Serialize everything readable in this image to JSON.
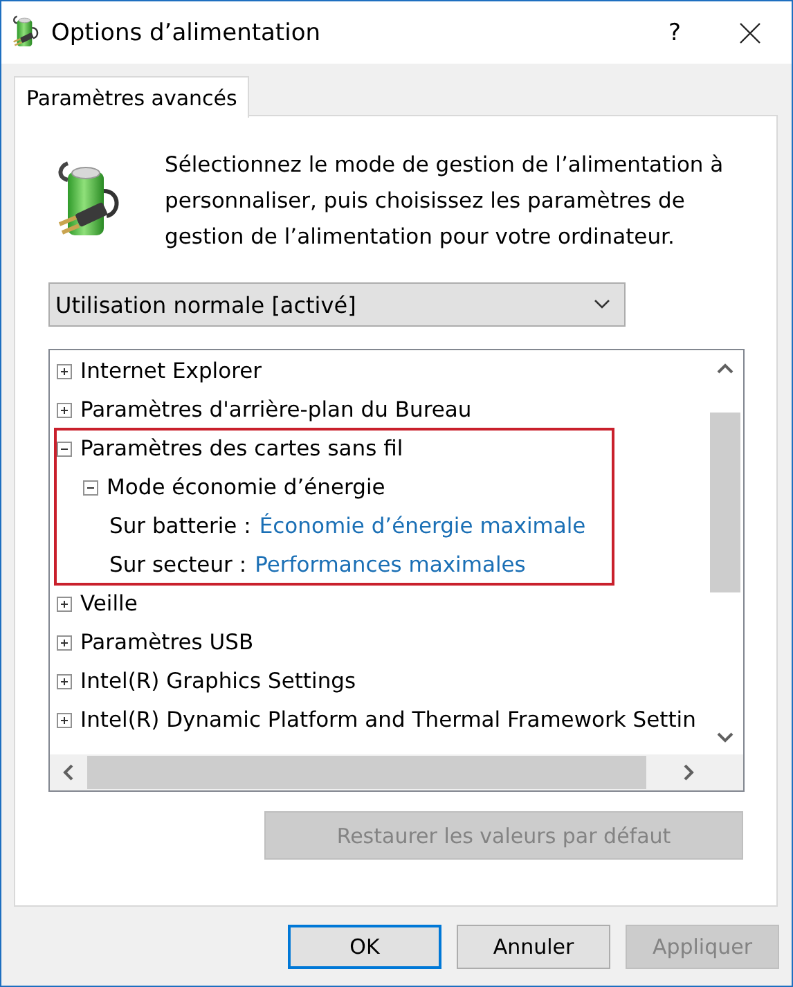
{
  "window": {
    "title": "Options d’alimentation",
    "help_button": "?"
  },
  "tabs": [
    {
      "label": "Paramètres avancés",
      "selected": true
    }
  ],
  "description": "Sélectionnez le mode de gestion de l’alimentation à personnaliser, puis choisissez les paramètres de gestion de l’alimentation pour votre ordinateur.",
  "plan_dropdown": {
    "value": "Utilisation normale [activé]"
  },
  "settings_tree": [
    {
      "kind": "group",
      "label": "Internet Explorer",
      "expanded": false,
      "highlighted": false
    },
    {
      "kind": "group",
      "label": "Paramètres d'arrière-plan du Bureau",
      "expanded": false,
      "highlighted": false
    },
    {
      "kind": "group",
      "label": "Paramètres des cartes sans fil",
      "expanded": true,
      "highlighted": true,
      "children": [
        {
          "kind": "group",
          "label": "Mode économie d’énergie",
          "expanded": true,
          "children": [
            {
              "kind": "value",
              "label": "Sur batterie :",
              "value": "Économie d’énergie maximale"
            },
            {
              "kind": "value",
              "label": "Sur secteur :",
              "value": "Performances maximales"
            }
          ]
        }
      ]
    },
    {
      "kind": "group",
      "label": "Veille",
      "expanded": false,
      "highlighted": false
    },
    {
      "kind": "group",
      "label": "Paramètres USB",
      "expanded": false,
      "highlighted": false
    },
    {
      "kind": "group",
      "label": "Intel(R) Graphics Settings",
      "expanded": false,
      "highlighted": false
    },
    {
      "kind": "group",
      "label": "Intel(R) Dynamic Platform and Thermal Framework Settin",
      "expanded": false,
      "highlighted": false
    }
  ],
  "restore_button": {
    "label": "Restaurer les valeurs par défaut",
    "disabled": true
  },
  "buttons": [
    {
      "label": "OK",
      "default": true,
      "disabled": false
    },
    {
      "label": "Annuler",
      "default": false,
      "disabled": false
    },
    {
      "label": "Appliquer",
      "default": false,
      "disabled": true
    }
  ]
}
